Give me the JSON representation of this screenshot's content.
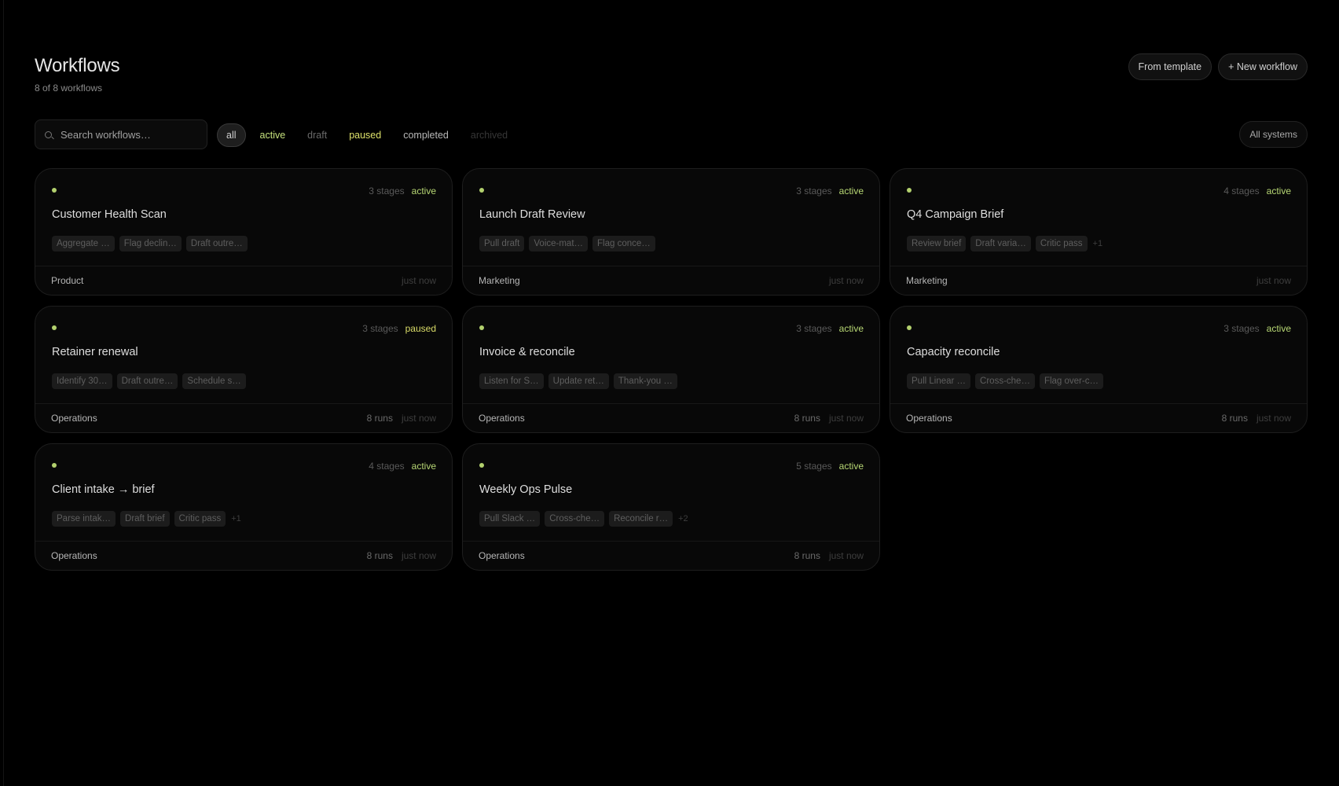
{
  "header": {
    "title": "Workflows",
    "subtitle": "8 of 8 workflows",
    "from_template_label": "From template",
    "new_workflow_label": "+ New workflow"
  },
  "toolbar": {
    "search_placeholder": "Search workflows…",
    "filters": [
      {
        "label": "all",
        "selected": true,
        "color": "#d0d0d0"
      },
      {
        "label": "active",
        "selected": false,
        "color": "#c6e27d"
      },
      {
        "label": "draft",
        "selected": false,
        "color": "#6a6a6a"
      },
      {
        "label": "paused",
        "selected": false,
        "color": "#dde16a"
      },
      {
        "label": "completed",
        "selected": false,
        "color": "#b8b8b8"
      },
      {
        "label": "archived",
        "selected": false,
        "color": "#363636"
      }
    ],
    "systems_label": "All systems"
  },
  "colors": {
    "active": "#b7d774",
    "paused": "#d9db68",
    "dot": "#b3d16e"
  },
  "workflows": [
    {
      "name": "Customer Health Scan",
      "stages": "3 stages",
      "status": "active",
      "steps": [
        "Aggregate …",
        "Flag declin…",
        "Draft outre…"
      ],
      "more": "",
      "team": "Product",
      "runs": "",
      "updated": "just now"
    },
    {
      "name": "Launch Draft Review",
      "stages": "3 stages",
      "status": "active",
      "steps": [
        "Pull draft",
        "Voice-mat…",
        "Flag conce…"
      ],
      "more": "",
      "team": "Marketing",
      "runs": "",
      "updated": "just now"
    },
    {
      "name": "Q4 Campaign Brief",
      "stages": "4 stages",
      "status": "active",
      "steps": [
        "Review brief",
        "Draft varia…",
        "Critic pass"
      ],
      "more": "+1",
      "team": "Marketing",
      "runs": "",
      "updated": "just now"
    },
    {
      "name": "Retainer renewal",
      "stages": "3 stages",
      "status": "paused",
      "steps": [
        "Identify 30…",
        "Draft outre…",
        "Schedule s…"
      ],
      "more": "",
      "team": "Operations",
      "runs": "8 runs",
      "updated": "just now"
    },
    {
      "name": "Invoice & reconcile",
      "stages": "3 stages",
      "status": "active",
      "steps": [
        "Listen for S…",
        "Update ret…",
        "Thank-you …"
      ],
      "more": "",
      "team": "Operations",
      "runs": "8 runs",
      "updated": "just now"
    },
    {
      "name": "Capacity reconcile",
      "stages": "3 stages",
      "status": "active",
      "steps": [
        "Pull Linear …",
        "Cross-che…",
        "Flag over-c…"
      ],
      "more": "",
      "team": "Operations",
      "runs": "8 runs",
      "updated": "just now"
    },
    {
      "name": "Client intake → brief",
      "stages": "4 stages",
      "status": "active",
      "steps": [
        "Parse intak…",
        "Draft brief",
        "Critic pass"
      ],
      "more": "+1",
      "team": "Operations",
      "runs": "8 runs",
      "updated": "just now"
    },
    {
      "name": "Weekly Ops Pulse",
      "stages": "5 stages",
      "status": "active",
      "steps": [
        "Pull Slack …",
        "Cross-che…",
        "Reconcile r…"
      ],
      "more": "+2",
      "team": "Operations",
      "runs": "8 runs",
      "updated": "just now"
    }
  ]
}
